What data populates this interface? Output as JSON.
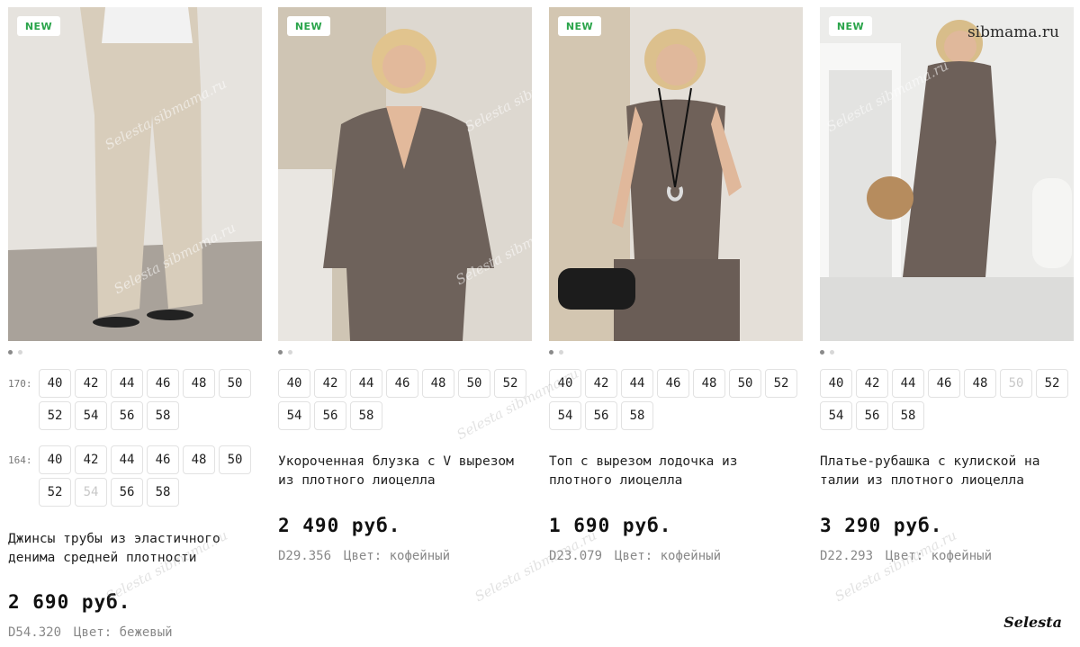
{
  "products": [
    {
      "badge": "NEW",
      "size_groups": [
        {
          "label": "170:",
          "sizes": [
            {
              "v": "40",
              "na": false
            },
            {
              "v": "42",
              "na": false
            },
            {
              "v": "44",
              "na": false
            },
            {
              "v": "46",
              "na": false
            },
            {
              "v": "48",
              "na": false
            },
            {
              "v": "50",
              "na": false
            },
            {
              "v": "52",
              "na": false
            },
            {
              "v": "54",
              "na": false
            },
            {
              "v": "56",
              "na": false
            },
            {
              "v": "58",
              "na": false
            }
          ]
        },
        {
          "label": "164:",
          "sizes": [
            {
              "v": "40",
              "na": false
            },
            {
              "v": "42",
              "na": false
            },
            {
              "v": "44",
              "na": false
            },
            {
              "v": "46",
              "na": false
            },
            {
              "v": "48",
              "na": false
            },
            {
              "v": "50",
              "na": false
            },
            {
              "v": "52",
              "na": false
            },
            {
              "v": "54",
              "na": true
            },
            {
              "v": "56",
              "na": false
            },
            {
              "v": "58",
              "na": false
            }
          ]
        }
      ],
      "title": "Джинсы трубы из эластичного денима средней плотности",
      "price": "2 690 руб.",
      "sku": "D54.320",
      "color": "Цвет: бежевый"
    },
    {
      "badge": "NEW",
      "size_groups": [
        {
          "label": "",
          "sizes": [
            {
              "v": "40",
              "na": false
            },
            {
              "v": "42",
              "na": false
            },
            {
              "v": "44",
              "na": false
            },
            {
              "v": "46",
              "na": false
            },
            {
              "v": "48",
              "na": false
            },
            {
              "v": "50",
              "na": false
            },
            {
              "v": "52",
              "na": false
            },
            {
              "v": "54",
              "na": false
            },
            {
              "v": "56",
              "na": false
            },
            {
              "v": "58",
              "na": false
            }
          ]
        }
      ],
      "title": "Укороченная блузка с V вырезом из плотного лиоцелла",
      "price": "2 490 руб.",
      "sku": "D29.356",
      "color": "Цвет: кофейный"
    },
    {
      "badge": "NEW",
      "size_groups": [
        {
          "label": "",
          "sizes": [
            {
              "v": "40",
              "na": false
            },
            {
              "v": "42",
              "na": false
            },
            {
              "v": "44",
              "na": false
            },
            {
              "v": "46",
              "na": false
            },
            {
              "v": "48",
              "na": false
            },
            {
              "v": "50",
              "na": false
            },
            {
              "v": "52",
              "na": false
            },
            {
              "v": "54",
              "na": false
            },
            {
              "v": "56",
              "na": false
            },
            {
              "v": "58",
              "na": false
            }
          ]
        }
      ],
      "title": "Топ с вырезом лодочка из плотного лиоцелла",
      "price": "1 690 руб.",
      "sku": "D23.079",
      "color": "Цвет: кофейный"
    },
    {
      "badge": "NEW",
      "size_groups": [
        {
          "label": "",
          "sizes": [
            {
              "v": "40",
              "na": false
            },
            {
              "v": "42",
              "na": false
            },
            {
              "v": "44",
              "na": false
            },
            {
              "v": "46",
              "na": false
            },
            {
              "v": "48",
              "na": false
            },
            {
              "v": "50",
              "na": true
            },
            {
              "v": "52",
              "na": false
            },
            {
              "v": "54",
              "na": false
            },
            {
              "v": "56",
              "na": false
            },
            {
              "v": "58",
              "na": false
            }
          ]
        }
      ],
      "title": "Платье-рубашка с кулиской на талии из плотного лиоцелла",
      "price": "3 290 руб.",
      "sku": "D22.293",
      "color": "Цвет: кофейный"
    }
  ],
  "watermarks": {
    "site": "sibmama.ru",
    "brand": "Selesta",
    "overlay": "Selesta sibmama.ru"
  },
  "colors": {
    "badge_text": "#2aa44a",
    "chip_border": "#e2e2e2",
    "muted_text": "#888888",
    "unavailable_size": "#c8c8c8"
  }
}
